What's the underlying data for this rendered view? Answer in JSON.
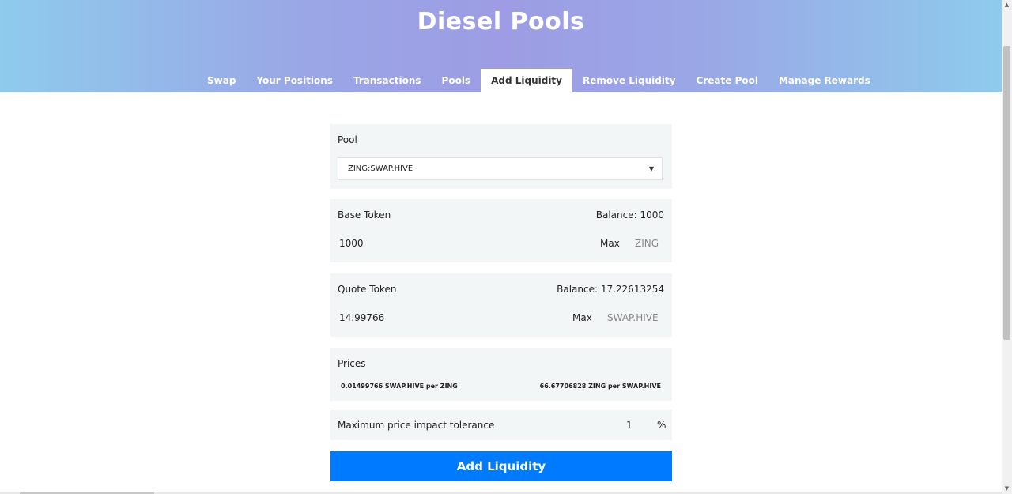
{
  "header": {
    "title": "Diesel Pools",
    "tabs": [
      "Swap",
      "Your Positions",
      "Transactions",
      "Pools",
      "Add Liquidity",
      "Remove Liquidity",
      "Create Pool",
      "Manage Rewards"
    ],
    "active_tab": "Add Liquidity"
  },
  "pool": {
    "label": "Pool",
    "selected": "ZING:SWAP.HIVE"
  },
  "base_token": {
    "label": "Base Token",
    "balance": "Balance: 1000",
    "amount": "1000",
    "max": "Max",
    "symbol": "ZING"
  },
  "quote_token": {
    "label": "Quote Token",
    "balance": "Balance: 17.22613254",
    "amount": "14.99766",
    "max": "Max",
    "symbol": "SWAP.HIVE"
  },
  "prices": {
    "label": "Prices",
    "quote_per_base": "0.01499766 SWAP.HIVE per ZING",
    "base_per_quote": "66.67706828 ZING per SWAP.HIVE"
  },
  "impact": {
    "label": "Maximum price impact tolerance",
    "value": "1",
    "unit": "%"
  },
  "submit": {
    "label": "Add Liquidity"
  },
  "colors": {
    "accent": "#007bff",
    "card_bg": "#f2f6f7"
  }
}
